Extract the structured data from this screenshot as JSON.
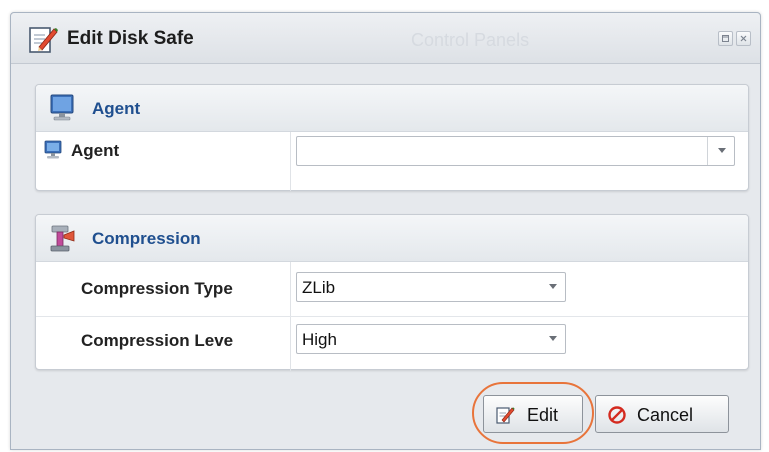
{
  "dialog": {
    "title": "Edit Disk Safe",
    "background_title": "Control Panels",
    "title_icon": "edit-note-icon",
    "window_buttons": [
      "maximize-icon",
      "close-icon"
    ]
  },
  "agent_section": {
    "header": "Agent",
    "header_icon": "computer-monitor-icon",
    "fields": [
      {
        "label": "Agent",
        "icon": "computer-small-icon",
        "value": "",
        "placeholder": ""
      }
    ]
  },
  "compression_section": {
    "header": "Compression",
    "header_icon": "compression-vise-icon",
    "fields": [
      {
        "label": "Compression Type",
        "value": "ZLib"
      },
      {
        "label": "Compression Leve",
        "value": "High"
      }
    ]
  },
  "buttons": {
    "edit_label": "Edit",
    "cancel_label": "Cancel"
  },
  "colors": {
    "section_header_text": "#1f4f8f",
    "highlight_ring": "#e8743b",
    "cancel_icon": "#d42a1f"
  }
}
